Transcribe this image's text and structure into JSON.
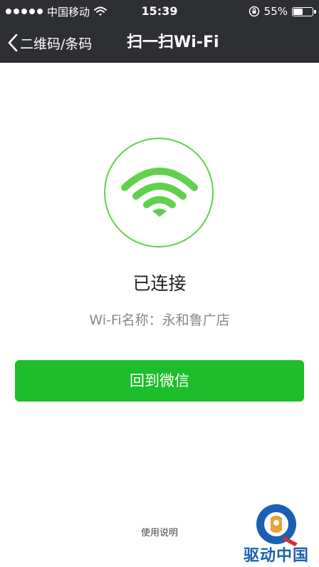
{
  "status_bar": {
    "carrier": "中国移动",
    "time": "15:39",
    "battery": "55%",
    "battery_level": 0.55
  },
  "nav": {
    "back_label": "二维码/条码",
    "title": "扫一扫Wi-Fi"
  },
  "main": {
    "status_text": "已连接",
    "wifi_name": "Wi-Fi名称：永和鲁广店",
    "return_button": "回到微信",
    "help_link": "使用说明"
  },
  "watermark": {
    "text": "驱动中国"
  },
  "colors": {
    "nav_bg": "#2d2f33",
    "accent_green": "#1dbd2b",
    "wifi_green": "#62d04f",
    "watermark_blue": "#1a5fb4"
  }
}
